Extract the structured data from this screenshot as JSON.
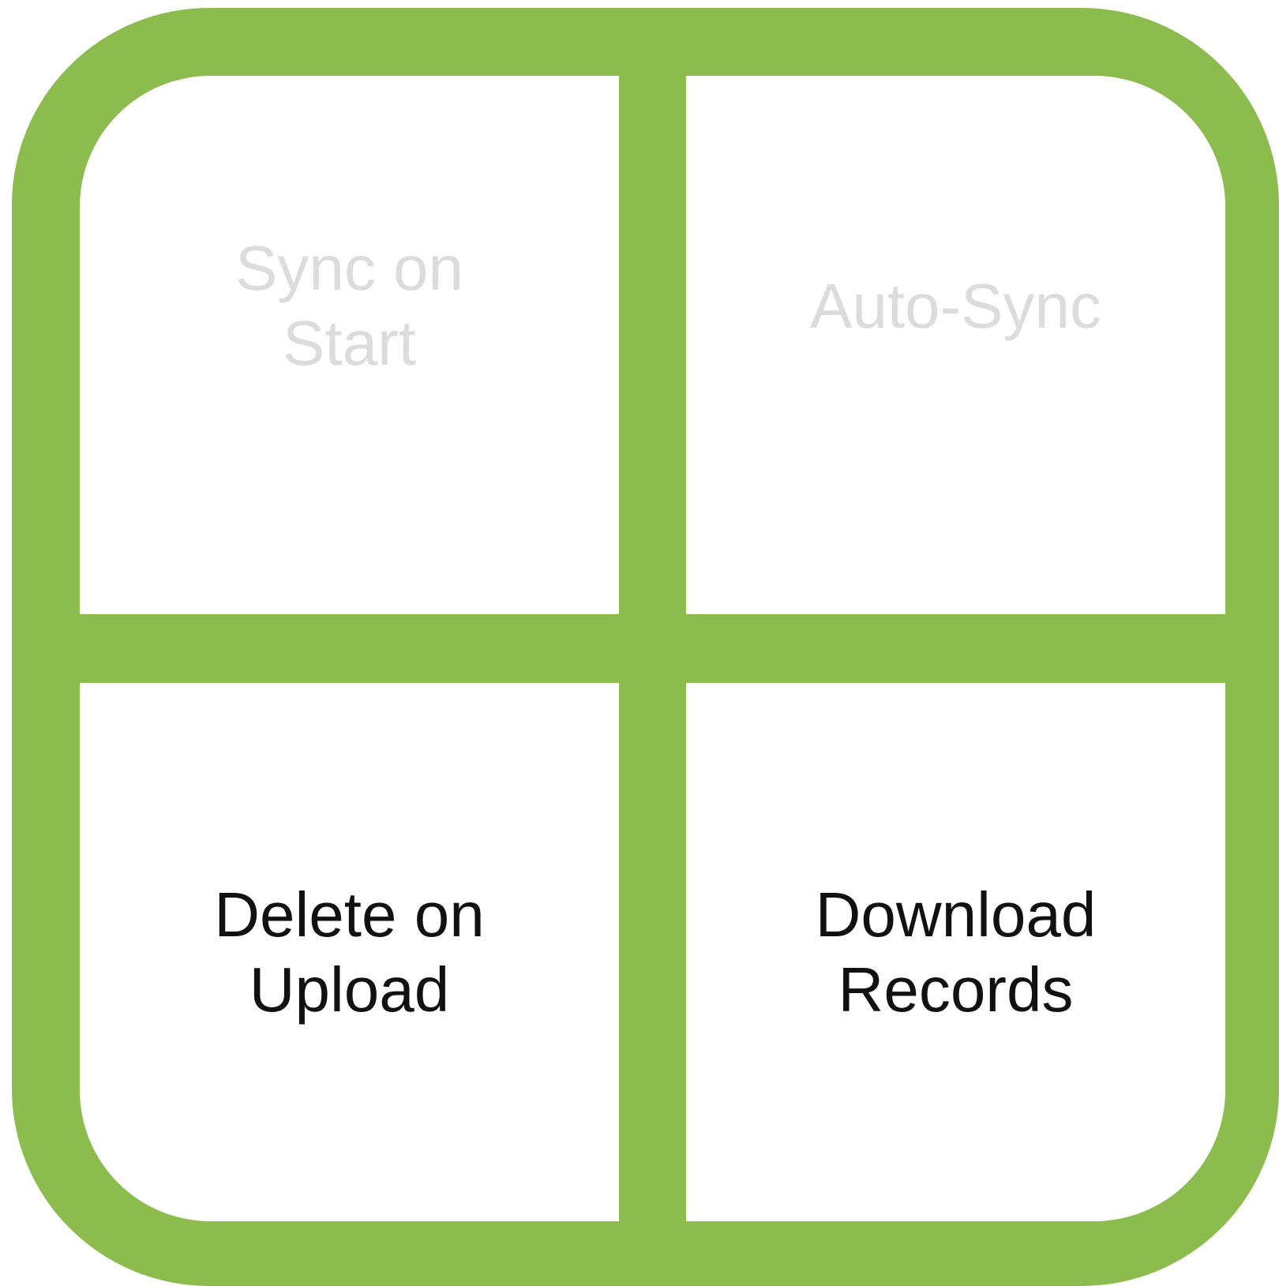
{
  "colors": {
    "accent": "#8bbc4d",
    "disabled_text": "#dcdcdc",
    "enabled_text": "#111111",
    "tile_background": "#ffffff"
  },
  "tiles": [
    {
      "label": "Sync on\nStart",
      "state": "disabled"
    },
    {
      "label": "Auto-Sync",
      "state": "disabled"
    },
    {
      "label": "Delete on\nUpload",
      "state": "enabled"
    },
    {
      "label": "Download\nRecords",
      "state": "enabled"
    }
  ]
}
